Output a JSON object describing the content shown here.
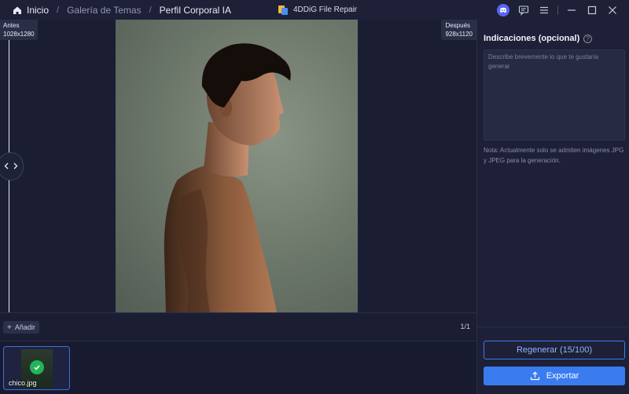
{
  "titlebar": {
    "app_title": "4DDiG File Repair",
    "breadcrumbs": [
      "Inicio",
      "Galería de Temas",
      "Perfil Corporal IA"
    ],
    "icons": [
      "home-icon",
      "discord-icon",
      "feedback-icon",
      "menu-icon",
      "minimize-icon",
      "maximize-icon",
      "close-icon"
    ]
  },
  "compare": {
    "before_label": "Antes",
    "before_size": "1028x1280",
    "after_label": "Después",
    "after_size": "928x1120"
  },
  "toolbar": {
    "add_label": "Añadir",
    "page_count": "1/1"
  },
  "thumbnails": [
    {
      "filename": "chico.jpg",
      "selected": true,
      "done": true
    }
  ],
  "panel": {
    "title": "Indicaciones (opcional)",
    "prompt_value": "",
    "prompt_placeholder": "Describe brevemente lo que te gustaría generar",
    "note": "Nota: Actualmente solo se admiten imágenes JPG y JPEG para la generación.",
    "regenerate_label": "Regenerar (15/100)",
    "export_label": "Exportar"
  },
  "colors": {
    "background": "#1b1e33",
    "panel": "#1d2036",
    "accent": "#3a7bf0",
    "success": "#22b45a"
  }
}
